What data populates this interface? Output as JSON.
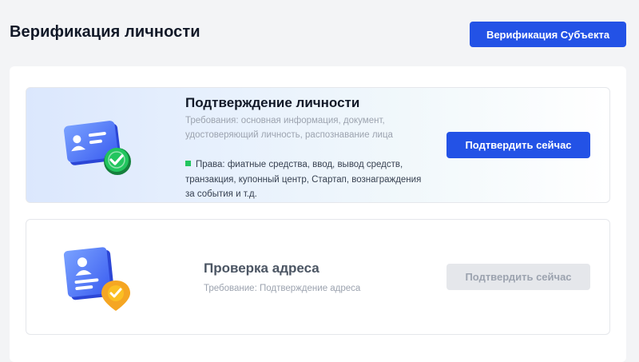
{
  "page": {
    "title": "Верификация личности",
    "subject_button": "Верификация Субъекта"
  },
  "identity": {
    "title": "Подтверждение личности",
    "requirements_line1": "Требования: основная информация, документ,",
    "requirements_line2": "удостоверяющий личность, распознавание лица",
    "rights_line1": "Права: фиатные средства, ввод, вывод средств,",
    "rights_line2": "транзакция, купонный центр, Стартап, вознаграждения",
    "rights_line3": "за события и т.д.",
    "button": "Подтвердить сейчас",
    "icon": "id-card-check-icon"
  },
  "address": {
    "title": "Проверка адреса",
    "requirement": "Требование: Подтверждение адреса",
    "button": "Подтвердить сейчас",
    "icon": "address-doc-location-icon"
  },
  "colors": {
    "primary": "#2352e6",
    "success": "#22c55e",
    "warning": "#f5a623",
    "disabled_bg": "#e5e7eb"
  }
}
